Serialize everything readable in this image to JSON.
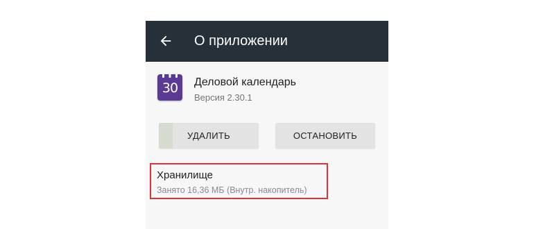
{
  "appbar": {
    "back_icon": "arrow-back-icon",
    "title": "О приложении",
    "background": "#253038"
  },
  "app": {
    "icon": "calendar-icon",
    "icon_day": "30",
    "icon_color": "#5b3a93",
    "name": "Деловой календарь",
    "version": "Версия 2.30.1"
  },
  "actions": {
    "uninstall_label": "УДАЛИТЬ",
    "stop_label": "ОСТАНОВИТЬ"
  },
  "storage": {
    "title": "Хранилище",
    "summary": "Занято 16,36 МБ (Внутр. накопитель)"
  },
  "annotation": {
    "highlight_color": "#e0303a"
  }
}
